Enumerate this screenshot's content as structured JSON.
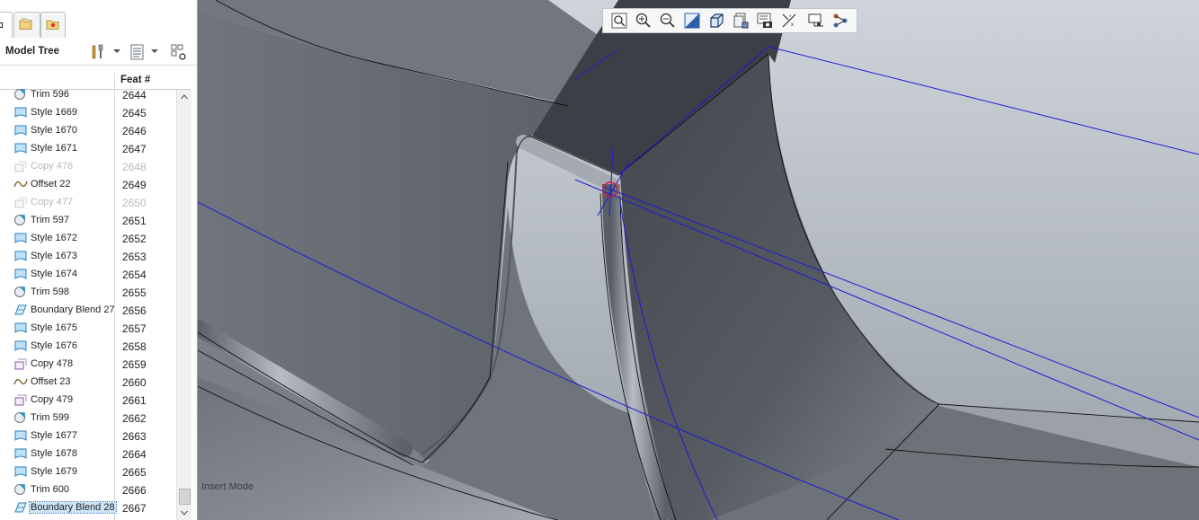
{
  "tree": {
    "title": "Model Tree",
    "column_feat": "Feat #",
    "rows": [
      {
        "name": "Trim 596",
        "num": "2644",
        "icon": "trim-icon",
        "state": "normal"
      },
      {
        "name": "Style 1669",
        "num": "2645",
        "icon": "style-icon",
        "state": "normal"
      },
      {
        "name": "Style 1670",
        "num": "2646",
        "icon": "style-icon",
        "state": "normal"
      },
      {
        "name": "Style 1671",
        "num": "2647",
        "icon": "style-icon",
        "state": "normal"
      },
      {
        "name": "Copy 476",
        "num": "2648",
        "icon": "copy-icon",
        "state": "suppressed"
      },
      {
        "name": "Offset 22",
        "num": "2649",
        "icon": "offset-icon",
        "state": "normal"
      },
      {
        "name": "Copy 477",
        "num": "2650",
        "icon": "copy-icon",
        "state": "suppressed"
      },
      {
        "name": "Trim 597",
        "num": "2651",
        "icon": "trim-icon",
        "state": "normal"
      },
      {
        "name": "Style 1672",
        "num": "2652",
        "icon": "style-icon",
        "state": "normal"
      },
      {
        "name": "Style 1673",
        "num": "2653",
        "icon": "style-icon",
        "state": "normal"
      },
      {
        "name": "Style 1674",
        "num": "2654",
        "icon": "style-icon",
        "state": "normal"
      },
      {
        "name": "Trim 598",
        "num": "2655",
        "icon": "trim-icon",
        "state": "normal"
      },
      {
        "name": "Boundary Blend 27",
        "num": "2656",
        "icon": "boundary-blend-icon",
        "state": "normal"
      },
      {
        "name": "Style 1675",
        "num": "2657",
        "icon": "style-icon",
        "state": "normal"
      },
      {
        "name": "Style 1676",
        "num": "2658",
        "icon": "style-icon",
        "state": "normal"
      },
      {
        "name": "Copy 478",
        "num": "2659",
        "icon": "copy-icon",
        "state": "normal"
      },
      {
        "name": "Offset 23",
        "num": "2660",
        "icon": "offset-icon",
        "state": "normal"
      },
      {
        "name": "Copy 479",
        "num": "2661",
        "icon": "copy-icon",
        "state": "normal"
      },
      {
        "name": "Trim 599",
        "num": "2662",
        "icon": "trim-icon",
        "state": "normal"
      },
      {
        "name": "Style 1677",
        "num": "2663",
        "icon": "style-icon",
        "state": "normal"
      },
      {
        "name": "Style 1678",
        "num": "2664",
        "icon": "style-icon",
        "state": "normal"
      },
      {
        "name": "Style 1679",
        "num": "2665",
        "icon": "style-icon",
        "state": "normal"
      },
      {
        "name": "Trim 600",
        "num": "2666",
        "icon": "trim-icon",
        "state": "normal"
      },
      {
        "name": "Boundary Blend 28",
        "num": "2667",
        "icon": "boundary-blend-icon",
        "state": "selected"
      }
    ]
  },
  "graphics_toolbar": {
    "buttons": [
      "refit-icon",
      "zoom-in-icon",
      "zoom-out-icon",
      "repaint-icon",
      "display-style-icon",
      "saved-orientations-icon",
      "view-manager-icon",
      "datum-display-icon",
      "annotation-display-icon",
      "spin-center-icon"
    ]
  },
  "status": {
    "mode_text": "Insert Mode"
  },
  "colors": {
    "model_surface": "#6b7077",
    "model_dark": "#3c3f45",
    "background_top": "#cdd2d8",
    "curve_blue": "#1c1cd6",
    "selection_red": "#d81c2a",
    "selected_row": "#cce4f7"
  }
}
